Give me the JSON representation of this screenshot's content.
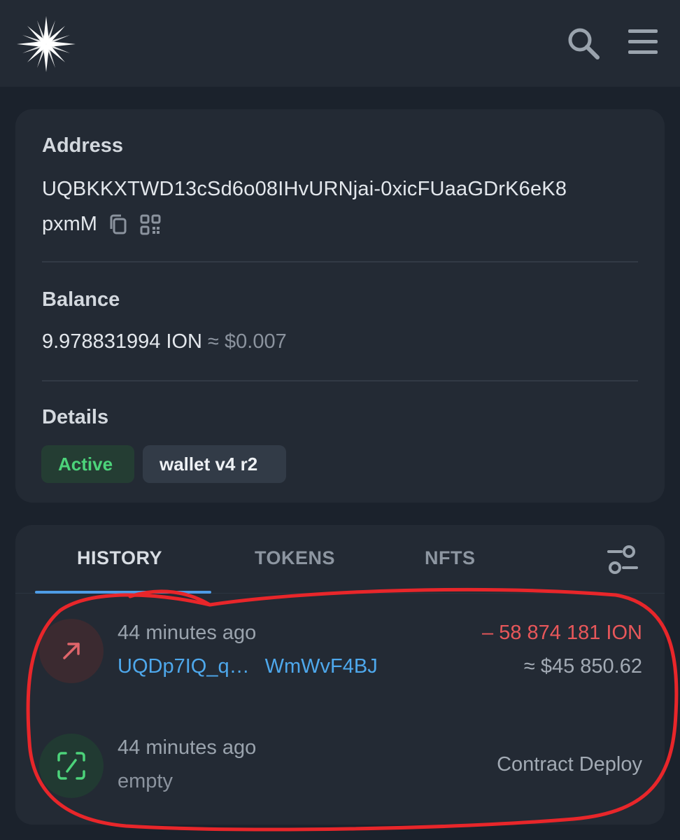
{
  "colors": {
    "page_bg": "#1b222c",
    "card_bg": "#232a34",
    "accent_blue": "#4e9ce6",
    "active_green": "#4cd37a",
    "outgoing_red": "#e8575a",
    "annotation_red": "#e8262a"
  },
  "header": {
    "logo_icon": "star-compass-icon",
    "search_icon": "search-icon",
    "menu_icon": "hamburger-menu-icon"
  },
  "account": {
    "address_label": "Address",
    "address_line1": "UQBKKXTWD13cSd6o08IHvURNjai-0xicFUaaGDrK6eK8",
    "address_line2": "pxmM",
    "copy_icon": "copy-icon",
    "qr_icon": "qr-code-icon",
    "balance_label": "Balance",
    "balance_amount": "9.978831994 ION",
    "balance_usd": "≈ $0.007",
    "details_label": "Details",
    "status_badge": "Active",
    "wallet_badge": "wallet v4 r2"
  },
  "tabs": [
    {
      "label": "HISTORY",
      "active": true
    },
    {
      "label": "TOKENS",
      "active": false
    },
    {
      "label": "NFTS",
      "active": false
    }
  ],
  "filter_icon": "filter-sliders-icon",
  "transactions": [
    {
      "icon": "arrow-up-right-icon",
      "time": "44 minutes ago",
      "address_start": "UQDp7IQ_q…",
      "address_end": "WmWvF4BJ",
      "amount": "– 58 874 181 ION",
      "usd": "≈ $45 850.62"
    },
    {
      "icon": "contract-deploy-icon",
      "time": "44 minutes ago",
      "subtitle": "empty",
      "kind": "Contract Deploy"
    }
  ]
}
